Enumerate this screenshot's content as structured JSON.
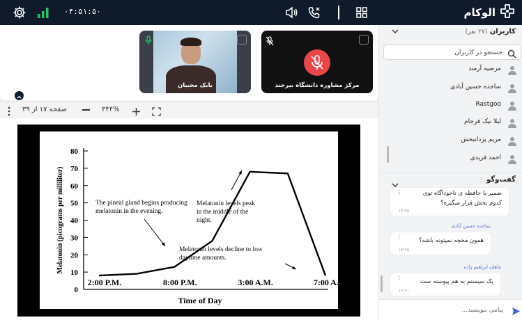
{
  "header": {
    "brand": "الوکام",
    "clock": "۰۴:۵۱:۵۰",
    "icons": [
      "settings-icon",
      "signal-icon",
      "speaker-icon",
      "hangup-call-icon",
      "grid-layout-icon",
      "logo-icon"
    ]
  },
  "videos": [
    {
      "name": "مرکز مشاوره دانشگاه بیرجند",
      "mic": "muted",
      "camera": "off"
    },
    {
      "name": "بابک محبیان",
      "mic": "on",
      "camera": "on"
    }
  ],
  "pdf_toolbar": {
    "page_label": "صفحه ۱۷ از ۳۹",
    "zoom": "۳۴۴%"
  },
  "slide": {
    "chart_data": {
      "type": "line",
      "x": [
        "2:00 P.M.",
        "",
        "8:00 P.M.",
        "",
        "3:00 A.M.",
        "",
        "7:00 A.M."
      ],
      "values": [
        8,
        9,
        13,
        28,
        68,
        67,
        8
      ],
      "xlabel": "Time of Day",
      "ylabel": "Melatonin (picograms per milliliter)",
      "xticks": [
        "2:00 P.M.",
        "8:00 P.M.",
        "3:00 A.M.",
        "7:00 A.M."
      ],
      "yticks": [
        "0",
        "10",
        "20",
        "30",
        "40",
        "50",
        "60",
        "70",
        "80"
      ],
      "ylim": [
        0,
        80
      ],
      "annotations": [
        [
          "The pineal gland begins producing",
          "melatonin in the evening."
        ],
        [
          "Melatonin levels peak",
          "in the middle of the",
          "night."
        ],
        [
          "Melatonin levels decline to low",
          "daytime amounts."
        ]
      ]
    }
  },
  "users_panel": {
    "title": "کاربران",
    "count": "(۲۷ نفر)",
    "search_placeholder": "جستجو در کاربران",
    "users": [
      "مرضیه آرمند",
      "ساجده حسین آبادی",
      "Rastgoo",
      "لیلا نیک فرجام",
      "مریم یزدانبخش",
      "احمد فریدی"
    ]
  },
  "chat_panel": {
    "title": "گفت‌وگو",
    "messages": [
      {
        "sender": "",
        "lines": [
          "ضمیر یا حافظه ی ناخوداگاه توی",
          "کدوم بخش قرار میگیره؟"
        ],
        "time": "۱۳:۴۵"
      },
      {
        "sender": "ساجده حسین آبادی",
        "lines": [
          "همون مخچه نمیتونه باشه؟"
        ],
        "time": "۱۳:۴۵"
      },
      {
        "sender": "ماهان ابراهیم زاده",
        "lines": [
          "یک سیستم به هم پیوسته ست"
        ],
        "time": "۱۳:۴۱"
      }
    ],
    "input_placeholder": "پیامی بنویسید..."
  }
}
